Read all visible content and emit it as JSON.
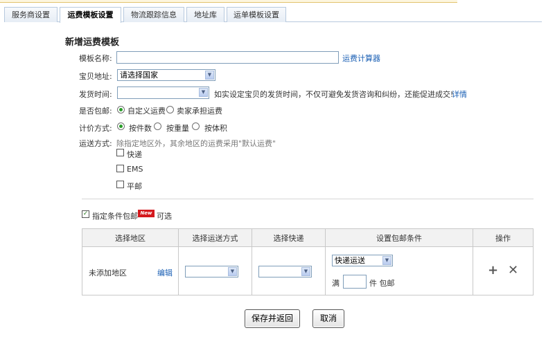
{
  "tabs": [
    {
      "label": "服务商设置",
      "active": false
    },
    {
      "label": "运费模板设置",
      "active": true
    },
    {
      "label": "物流跟踪信息",
      "active": false
    },
    {
      "label": "地址库",
      "active": false
    },
    {
      "label": "运单模板设置",
      "active": false
    }
  ],
  "form": {
    "title": "新增运费模板",
    "template_name": {
      "label": "模板名称:",
      "value": "",
      "link": "运费计算器"
    },
    "address": {
      "label": "宝贝地址:",
      "selected": "请选择国家"
    },
    "ship_time": {
      "label": "发货时间:",
      "selected": "",
      "hint": "如实设定宝贝的发货时间，不仅可避免发货咨询和纠纷，还能促进成交!",
      "link": "详情"
    },
    "free_shipping": {
      "label": "是否包邮:",
      "options": [
        "自定义运费",
        "卖家承担运费"
      ],
      "selected": "自定义运费"
    },
    "pricing": {
      "label": "计价方式:",
      "options": [
        "按件数",
        "按重量",
        "按体积"
      ],
      "selected": "按件数"
    },
    "delivery": {
      "label": "运送方式:",
      "hint": "除指定地区外，其余地区的运费采用\"默认运费\"",
      "methods": [
        {
          "label": "快递",
          "checked": false
        },
        {
          "label": "EMS",
          "checked": false
        },
        {
          "label": "平邮",
          "checked": false
        }
      ]
    }
  },
  "conditional": {
    "checkbox_label": "指定条件包邮",
    "checked": true,
    "badge": "New",
    "suffix": "可选"
  },
  "table": {
    "headers": [
      "选择地区",
      "选择运送方式",
      "选择快递",
      "设置包邮条件",
      "操作"
    ],
    "row": {
      "region": "未添加地区",
      "edit_link": "编辑",
      "condition_select": "快递运送",
      "condition_prefix": "满",
      "condition_value": "",
      "condition_suffix": "件 包邮",
      "add_icon": "plus-icon",
      "delete_icon": "close-icon"
    }
  },
  "actions": {
    "save_label": "保存并返回",
    "cancel_label": "取消"
  }
}
